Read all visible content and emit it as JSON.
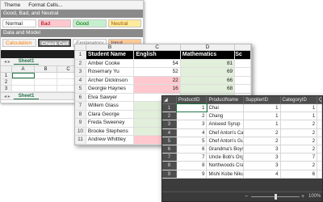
{
  "theme_window": {
    "menu": [
      "Theme",
      "Format Cells..."
    ],
    "group1_title": "Good, Bad, and Neutral",
    "group1_styles": [
      {
        "label": "Normal",
        "bg": "#ffffff",
        "fg": "#222222"
      },
      {
        "label": "Bad",
        "bg": "#ffc7ce",
        "fg": "#9c0006"
      },
      {
        "label": "Good",
        "bg": "#c6efce",
        "fg": "#006100"
      },
      {
        "label": "Neutral",
        "bg": "#ffeb9c",
        "fg": "#9c5700"
      }
    ],
    "group2_title": "Data and Model",
    "group2_styles": [
      {
        "label": "Calculation",
        "bg": "#f2f2f2",
        "fg": "#fa7d00"
      },
      {
        "label": "Check Cell",
        "bg": "#a5a5a5",
        "fg": "#ffffff"
      },
      {
        "label": "Explanatory ...",
        "bg": "#ffffff",
        "fg": "#7f7f7f"
      },
      {
        "label": "Input",
        "bg": "#ffcc99",
        "fg": "#3f3f76"
      }
    ],
    "sheet_tab": "Sheet1",
    "sheet_tab_2": "Sheet1",
    "mini_cols": [
      "A",
      "B",
      "C"
    ],
    "mini_rows": [
      "1",
      "2",
      "3"
    ]
  },
  "grades_window": {
    "columns": [
      "A",
      "B",
      "C",
      "D"
    ],
    "header": {
      "name": "Student Name",
      "english": "English",
      "math": "Mathematics",
      "extra": "Sc"
    },
    "rows": [
      {
        "n": "2",
        "name": "Amber Cooke",
        "english": "54",
        "math": "81",
        "eng_bg": "#ffffff",
        "math_bg": "#e2efda"
      },
      {
        "n": "3",
        "name": "Rosemary Yu",
        "english": "52",
        "math": "69",
        "eng_bg": "#ffffff",
        "math_bg": "#e2efda"
      },
      {
        "n": "4",
        "name": "Archer Dickinson",
        "english": "22",
        "math": "66",
        "eng_bg": "#ffc7ce",
        "math_bg": "#e2efda"
      },
      {
        "n": "5",
        "name": "Georgie Haynes",
        "english": "16",
        "math": "68",
        "eng_bg": "#ffc7ce",
        "math_bg": "#e2efda"
      },
      {
        "n": "6",
        "name": "Elva Sawyer",
        "english": "",
        "math": "",
        "eng_bg": "#ffffff",
        "math_bg": "#e2efda"
      },
      {
        "n": "7",
        "name": "Willem Glass",
        "english": "",
        "math": "",
        "eng_bg": "#e2efda",
        "math_bg": "#e2efda"
      },
      {
        "n": "8",
        "name": "Clara George",
        "english": "",
        "math": "",
        "eng_bg": "#e2efda",
        "math_bg": "#ffffff"
      },
      {
        "n": "9",
        "name": "Freda Sweeney",
        "english": "",
        "math": "",
        "eng_bg": "#e2efda",
        "math_bg": "#ffffff"
      },
      {
        "n": "10",
        "name": "Brooke Stephens",
        "english": "",
        "math": "",
        "eng_bg": "#e2efda",
        "math_bg": "#ffffff"
      },
      {
        "n": "11",
        "name": "Andrew Whittley",
        "english": "",
        "math": "",
        "eng_bg": "#ffc7ce",
        "math_bg": "#ffffff"
      }
    ]
  },
  "products_window": {
    "columns": [
      "ProductID",
      "ProductName",
      "SupplierID",
      "CategoryID",
      "Q"
    ],
    "rows": [
      {
        "n": "1",
        "id": "1",
        "name": "Chai",
        "supplier": "1",
        "category": "1"
      },
      {
        "n": "2",
        "id": "2",
        "name": "Chang",
        "supplier": "1",
        "category": "1"
      },
      {
        "n": "3",
        "id": "3",
        "name": "Aniseed Syrup",
        "supplier": "1",
        "category": "2"
      },
      {
        "n": "4",
        "id": "4",
        "name": "Chef Anton's Caju",
        "supplier": "2",
        "category": "2"
      },
      {
        "n": "5",
        "id": "5",
        "name": "Chef Anton's Gum",
        "supplier": "2",
        "category": "2"
      },
      {
        "n": "6",
        "id": "6",
        "name": "Grandma's Boyse",
        "supplier": "3",
        "category": "2"
      },
      {
        "n": "7",
        "id": "7",
        "name": "Uncle Bob's Orga",
        "supplier": "3",
        "category": "7"
      },
      {
        "n": "8",
        "id": "8",
        "name": "Northwoods Crar",
        "supplier": "3",
        "category": "2"
      },
      {
        "n": "9",
        "id": "9",
        "name": "Mishi Kobe Niku",
        "supplier": "4",
        "category": "6"
      }
    ],
    "zoom": "100%"
  }
}
